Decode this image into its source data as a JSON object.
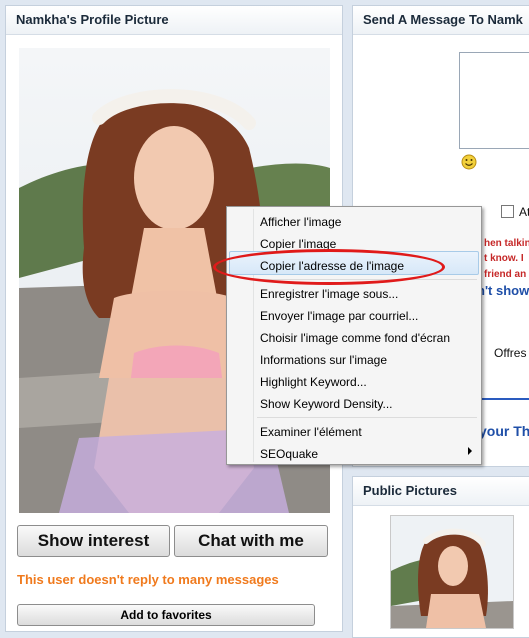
{
  "left": {
    "title": "Namkha's Profile Picture",
    "show_interest": "Show interest",
    "chat": "Chat with me",
    "no_reply": "This user doesn't reply to many messages",
    "favorites": "Add to favorites"
  },
  "right": {
    "message_title": "Send A Message To Namk",
    "checkbox_label": "At",
    "red_lines": [
      "hen talkin",
      "t know. I",
      "friend an"
    ],
    "blue_text": "n't show",
    "offres": "Offres",
    "blue_text2": "your Th",
    "public_title": "Public Pictures"
  },
  "context_menu": {
    "items": [
      "Afficher l'image",
      "Copier l'image",
      "Copier l'adresse de l'image",
      "Enregistrer l'image sous...",
      "Envoyer l'image par courriel...",
      "Choisir l'image comme fond d'écran",
      "Informations sur l'image",
      "Highlight Keyword...",
      "Show Keyword Density...",
      "Examiner l'élément",
      "SEOquake"
    ]
  },
  "colors": {
    "orange": "#f07a1d",
    "highlight_ellipse": "#e01a1a",
    "link_blue": "#1f4fa8"
  }
}
